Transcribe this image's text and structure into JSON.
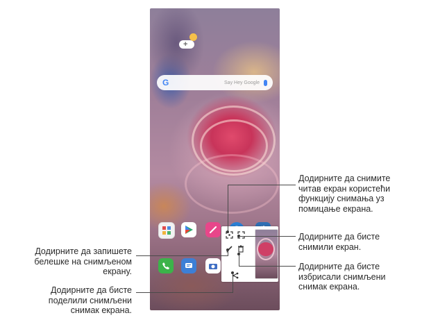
{
  "search": {
    "placeholder": "Say Hey Google"
  },
  "home_apps": [
    {
      "name": "apps-folder"
    },
    {
      "name": "play-store"
    },
    {
      "name": "pen"
    },
    {
      "name": "clock"
    },
    {
      "name": "settings"
    }
  ],
  "dock": [
    {
      "name": "phone"
    },
    {
      "name": "messages"
    },
    {
      "name": "camera"
    }
  ],
  "callouts": {
    "capture_scroll": [
      "Додирните да снимите",
      "читав екран користећи",
      "функцију снимања уз",
      "помицање екрана."
    ],
    "capture_screen": [
      "Додирните да бисте",
      "снимили екран."
    ],
    "write_note": [
      "Додирните да запишете",
      "белешке на снимљеном",
      "екрану."
    ],
    "delete": [
      "Додирните да бисте",
      "избрисали снимљени",
      "снимак екрана."
    ],
    "share": [
      "Додирните да бисте",
      "поделили снимљени",
      "снимак екрана."
    ]
  },
  "colors": {
    "accent_blue": "#4285f4",
    "play_green": "#27a96b",
    "pen_pink": "#e8468a",
    "clock_blue": "#2a7fd4",
    "settings_blue": "#2f6fb3",
    "phone_green": "#3cb34a"
  }
}
